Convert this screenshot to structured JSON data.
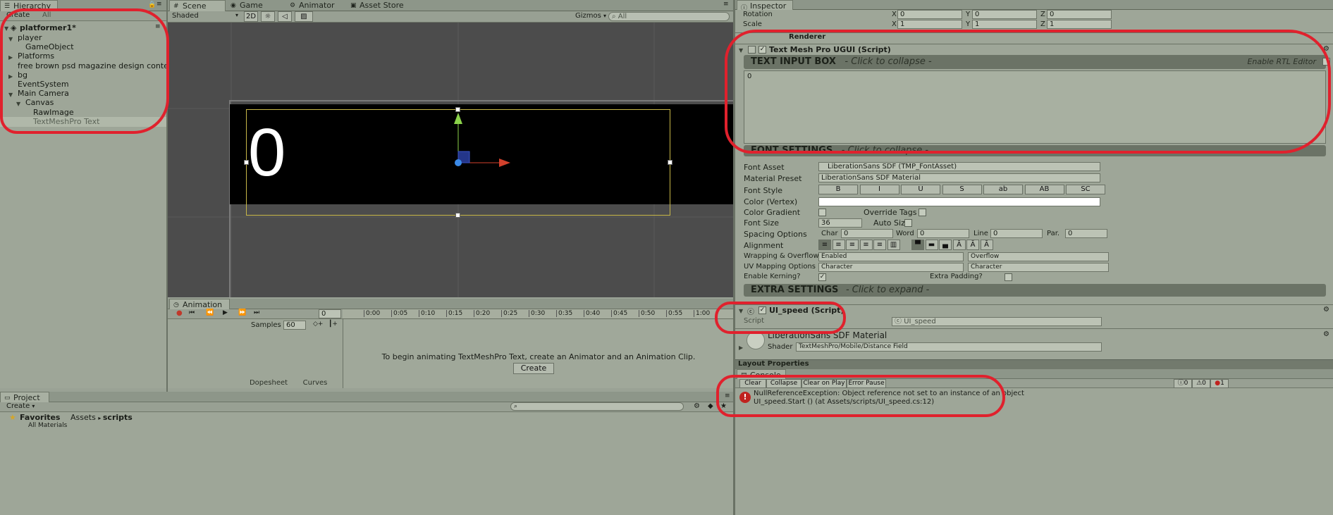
{
  "hierarchy": {
    "tab_label": "Hierarchy",
    "create_label": "Create",
    "search_placeholder": "All",
    "scene_name": "platformer1*",
    "items": [
      {
        "label": "player",
        "indent": 0,
        "arrow": "down"
      },
      {
        "label": "GameObject",
        "indent": 1,
        "arrow": ""
      },
      {
        "label": "Platforms",
        "indent": 0,
        "arrow": "right"
      },
      {
        "label": "free brown psd magazine design content pa",
        "indent": 0,
        "arrow": ""
      },
      {
        "label": "bg",
        "indent": 0,
        "arrow": "right"
      },
      {
        "label": "EventSystem",
        "indent": 0,
        "arrow": ""
      },
      {
        "label": "Main Camera",
        "indent": 0,
        "arrow": "down"
      },
      {
        "label": "Canvas",
        "indent": 1,
        "arrow": "down"
      },
      {
        "label": "RawImage",
        "indent": 2,
        "arrow": ""
      },
      {
        "label": "TextMeshPro Text",
        "indent": 2,
        "arrow": "",
        "selected": true
      }
    ]
  },
  "scene_tabs": [
    "Scene",
    "Game",
    "Animator",
    "Asset Store"
  ],
  "scene_toolbar": {
    "shading": "Shaded",
    "mode_2d": "2D",
    "gizmos": "Gizmos",
    "search_placeholder": "All"
  },
  "scene_view": {
    "display_text": "0"
  },
  "animation": {
    "tab_label": "Animation",
    "frame_value": "0",
    "samples_label": "Samples",
    "samples_value": "60",
    "timeline_ticks": [
      "0:00",
      "0:05",
      "0:10",
      "0:15",
      "0:20",
      "0:25",
      "0:30",
      "0:35",
      "0:40",
      "0:45",
      "0:50",
      "0:55",
      "1:00"
    ],
    "message": "To begin animating TextMeshPro Text, create an Animator and an Animation Clip.",
    "create_button": "Create",
    "dopesheet_label": "Dopesheet",
    "curves_label": "Curves"
  },
  "project": {
    "tab_label": "Project",
    "create_label": "Create",
    "favorites_label": "Favorites",
    "all_materials_label": "All Materials",
    "breadcrumb": [
      "Assets",
      "scripts"
    ]
  },
  "inspector": {
    "tab_label": "Inspector",
    "rotation": {
      "label": "Rotation",
      "x": "0",
      "y": "0",
      "z": "0"
    },
    "scale": {
      "label": "Scale",
      "x": "1",
      "y": "1",
      "z": "1"
    },
    "renderer_header": "Renderer",
    "tmp_component": "Text Mesh Pro UGUI (Script)",
    "text_input_box": "TEXT INPUT BOX",
    "text_input_hint": "- Click to collapse -",
    "enable_rtl": "Enable RTL Editor",
    "text_value": "0",
    "font_settings": "FONT SETTINGS",
    "font_settings_hint": "- Click to collapse -",
    "font_asset": {
      "label": "Font Asset",
      "value": "LiberationSans SDF (TMP_FontAsset)"
    },
    "material_preset": {
      "label": "Material Preset",
      "value": "LiberationSans SDF Material"
    },
    "font_style": {
      "label": "Font Style",
      "buttons": [
        "B",
        "I",
        "U",
        "S",
        "ab",
        "AB",
        "SC"
      ]
    },
    "color_vertex_label": "Color (Vertex)",
    "color_gradient_label": "Color Gradient",
    "override_tags_label": "Override Tags",
    "font_size": {
      "label": "Font Size",
      "value": "36"
    },
    "auto_size_label": "Auto Size",
    "spacing": {
      "label": "Spacing Options",
      "char_label": "Char",
      "char": "0",
      "word_label": "Word",
      "word": "0",
      "line_label": "Line",
      "line": "0",
      "par_label": "Par.",
      "par": "0"
    },
    "alignment_label": "Alignment",
    "wrapping": {
      "label": "Wrapping & Overflow",
      "value1": "Enabled",
      "value2": "Overflow"
    },
    "uv_mapping": {
      "label": "UV Mapping Options",
      "value1": "Character",
      "value2": "Character"
    },
    "kerning_label": "Enable Kerning?",
    "extra_padding_label": "Extra Padding?",
    "extra_settings": "EXTRA SETTINGS",
    "extra_settings_hint": "- Click to expand -",
    "ui_speed_component": "UI_speed (Script)",
    "script_label": "Script",
    "script_value": "UI_speed",
    "material_name": "LiberationSans SDF Material",
    "shader_label": "Shader",
    "shader_value": "TextMeshPro/Mobile/Distance Field",
    "layout_properties": "Layout Properties"
  },
  "console": {
    "tab_label": "Console",
    "buttons": [
      "Clear",
      "Collapse",
      "Clear on Play",
      "Error Pause"
    ],
    "counts": [
      "0",
      "0",
      "1"
    ],
    "error_line1": "NullReferenceException: Object reference not set to an instance of an object",
    "error_line2": "UI_speed.Start () (at Assets/scripts/UI_speed.cs:12)"
  }
}
